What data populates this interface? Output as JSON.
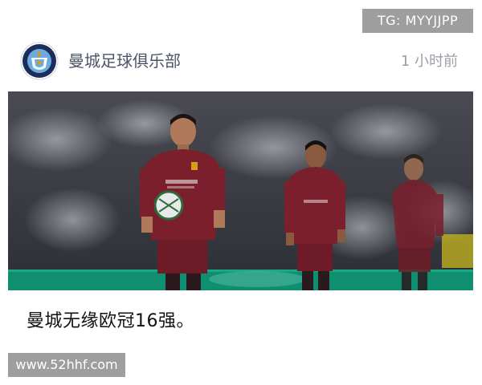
{
  "watermark_top": "TG: MYYJJPP",
  "post": {
    "account_name": "曼城足球俱乐部",
    "avatar_icon": "manchester-city-crest-icon",
    "timestamp": "1 小时前",
    "caption": "曼城无缘欧冠16强。",
    "photo": {
      "subject": "match-photo-players",
      "shirt_color": "#7a1f2b"
    }
  },
  "watermark_bottom": "www.52hhf.com"
}
